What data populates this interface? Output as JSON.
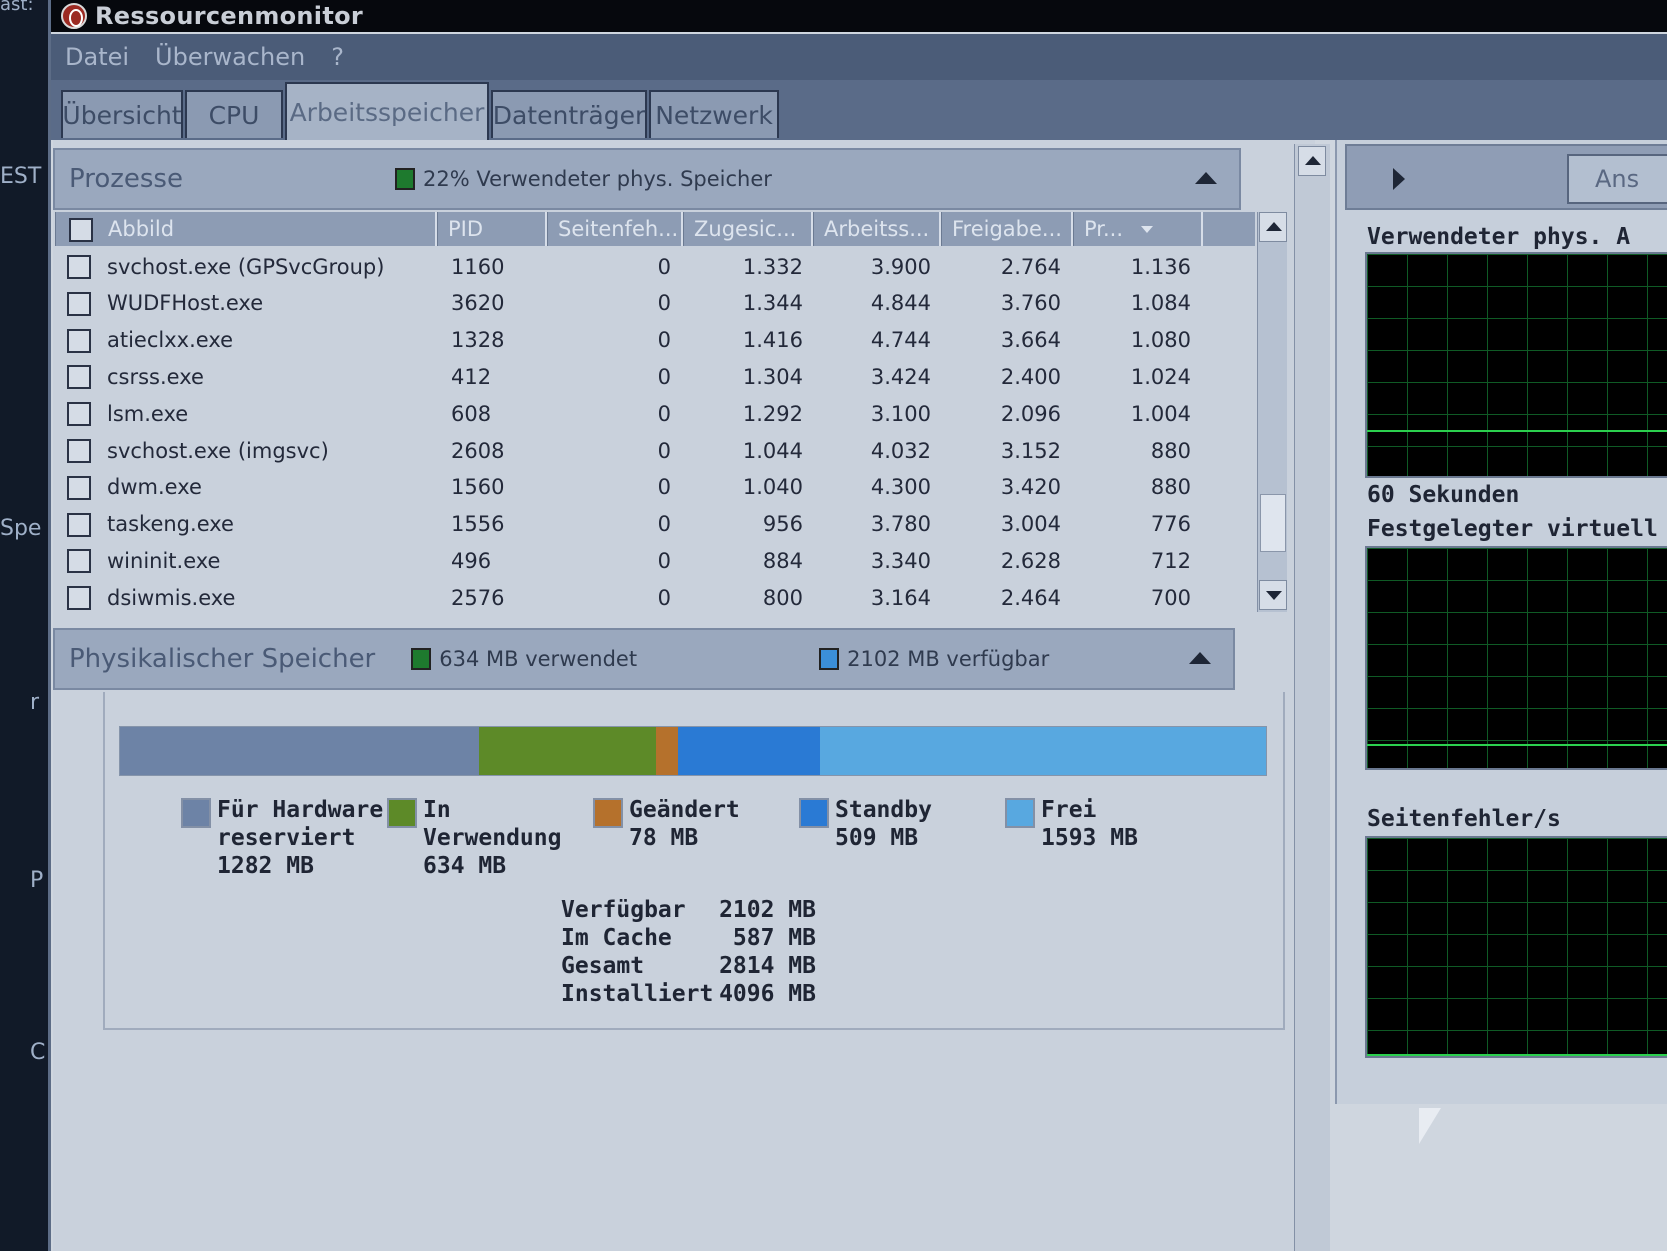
{
  "desktop": {
    "fragments": [
      "ast:",
      "EST",
      "Spe",
      "r",
      "P",
      "C"
    ]
  },
  "window": {
    "title": "Ressourcenmonitor"
  },
  "menu": [
    "Datei",
    "Überwachen",
    "?"
  ],
  "tabs": [
    {
      "label": "Übersicht",
      "active": false
    },
    {
      "label": "CPU",
      "active": false
    },
    {
      "label": "Arbeitsspeicher",
      "active": true
    },
    {
      "label": "Datenträger",
      "active": false
    },
    {
      "label": "Netzwerk",
      "active": false
    }
  ],
  "processes": {
    "title": "Prozesse",
    "status": "22% Verwendeter phys. Speicher",
    "status_color": "#1e7a2e",
    "columns": [
      "Abbild",
      "PID",
      "Seitenfeh...",
      "Zugesic...",
      "Arbeitss...",
      "Freigabe...",
      "Pr..."
    ],
    "rows": [
      [
        "svchost.exe (GPSvcGroup)",
        "1160",
        "0",
        "1.332",
        "3.900",
        "2.764",
        "1.136"
      ],
      [
        "WUDFHost.exe",
        "3620",
        "0",
        "1.344",
        "4.844",
        "3.760",
        "1.084"
      ],
      [
        "atieclxx.exe",
        "1328",
        "0",
        "1.416",
        "4.744",
        "3.664",
        "1.080"
      ],
      [
        "csrss.exe",
        "412",
        "0",
        "1.304",
        "3.424",
        "2.400",
        "1.024"
      ],
      [
        "lsm.exe",
        "608",
        "0",
        "1.292",
        "3.100",
        "2.096",
        "1.004"
      ],
      [
        "svchost.exe (imgsvc)",
        "2608",
        "0",
        "1.044",
        "4.032",
        "3.152",
        "880"
      ],
      [
        "dwm.exe",
        "1560",
        "0",
        "1.040",
        "4.300",
        "3.420",
        "880"
      ],
      [
        "taskeng.exe",
        "1556",
        "0",
        "956",
        "3.780",
        "3.004",
        "776"
      ],
      [
        "wininit.exe",
        "496",
        "0",
        "884",
        "3.340",
        "2.628",
        "712"
      ],
      [
        "dsiwmis.exe",
        "2576",
        "0",
        "800",
        "3.164",
        "2.464",
        "700"
      ]
    ]
  },
  "physical": {
    "title": "Physikalischer Speicher",
    "used_text": "634 MB verwendet",
    "used_color": "#1e7a2e",
    "available_text": "2102 MB verfügbar",
    "available_color": "#3b8fd8",
    "segments": [
      {
        "name": "Für Hardware reserviert",
        "mb": 1282,
        "color": "#6d83a6"
      },
      {
        "name": "In Verwendung",
        "mb": 634,
        "color": "#5d8a28"
      },
      {
        "name": "Geändert",
        "mb": 78,
        "color": "#b5712c"
      },
      {
        "name": "Standby",
        "mb": 509,
        "color": "#2a7ad4"
      },
      {
        "name": "Frei",
        "mb": 1593,
        "color": "#58a8e0"
      }
    ],
    "legend": [
      {
        "line1": "Für Hardware",
        "line2": "reserviert",
        "line3": "1282 MB",
        "color": "#6d83a6"
      },
      {
        "line1": "In",
        "line2": "Verwendung",
        "line3": "634 MB",
        "color": "#5d8a28"
      },
      {
        "line1": "Geändert",
        "line2": "78 MB",
        "line3": "",
        "color": "#b5712c"
      },
      {
        "line1": "Standby",
        "line2": "509 MB",
        "line3": "",
        "color": "#2a7ad4"
      },
      {
        "line1": "Frei",
        "line2": "1593 MB",
        "line3": "",
        "color": "#58a8e0"
      }
    ],
    "summary": [
      {
        "label": "Verfügbar",
        "value": "2102 MB"
      },
      {
        "label": "Im Cache",
        "value": "587 MB"
      },
      {
        "label": "Gesamt",
        "value": "2814 MB"
      },
      {
        "label": "Installiert",
        "value": "4096 MB"
      }
    ]
  },
  "side": {
    "button_label": "Ans",
    "graph1_title": "Verwendeter phys. A",
    "graph1_caption": "60 Sekunden",
    "graph2_title": "Festgelegter virtuell",
    "graph3_title": "Seitenfehler/s"
  }
}
